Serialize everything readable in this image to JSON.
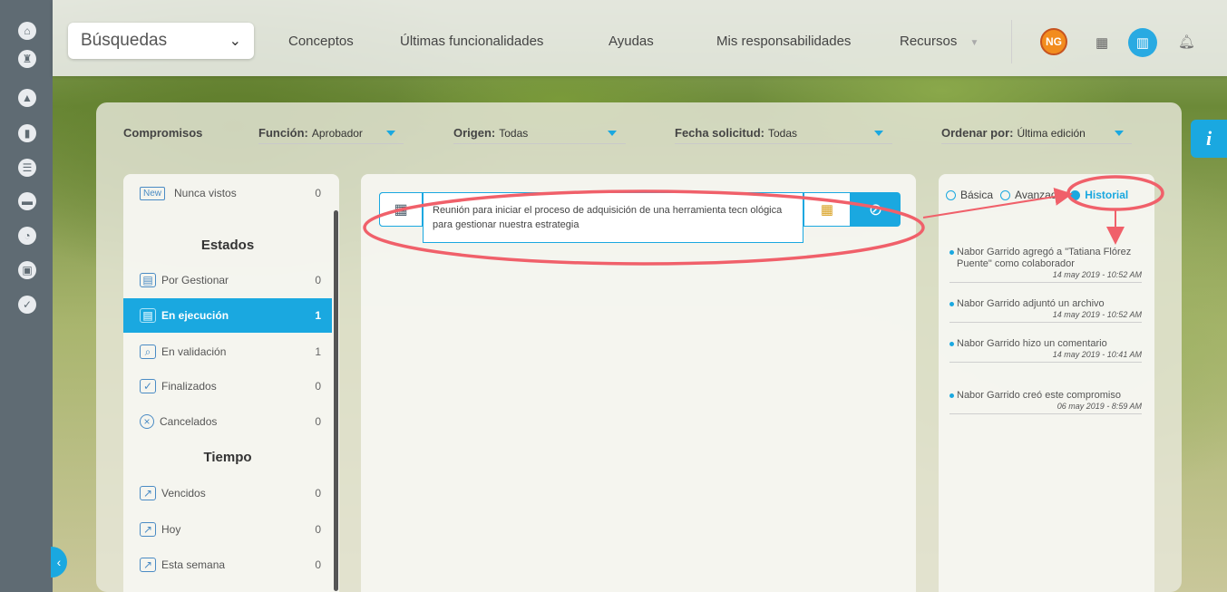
{
  "sidebar": {
    "icons": [
      "home-icon",
      "rook-icon",
      "pyramid-icon",
      "chart-icon",
      "steps-icon",
      "folder-icon",
      "clock-icon",
      "briefcase-icon",
      "check-icon"
    ]
  },
  "topbar": {
    "search_label": "Búsquedas",
    "nav": [
      "Conceptos",
      "Últimas funcionalidades",
      "Ayudas",
      "Mis responsabilidades",
      "Recursos"
    ],
    "avatar_initials": "NG",
    "info_label": "i"
  },
  "filters": {
    "section_label": "Compromisos",
    "funcion_label": "Función:",
    "funcion_value": "Aprobador",
    "origen_label": "Origen:",
    "origen_value": "Todas",
    "fecha_label": "Fecha solicitud:",
    "fecha_value": "Todas",
    "ordenar_label": "Ordenar por:",
    "ordenar_value": "Última edición"
  },
  "left": {
    "new_badge": "New",
    "nunca_vistos": "Nunca vistos",
    "nunca_vistos_count": "0",
    "estados_title": "Estados",
    "estados": [
      {
        "label": "Por Gestionar",
        "count": "0"
      },
      {
        "label": "En ejecución",
        "count": "1"
      },
      {
        "label": "En validación",
        "count": "1"
      },
      {
        "label": "Finalizados",
        "count": "0"
      },
      {
        "label": "Cancelados",
        "count": "0"
      }
    ],
    "tiempo_title": "Tiempo",
    "tiempo": [
      {
        "label": "Vencidos",
        "count": "0"
      },
      {
        "label": "Hoy",
        "count": "0"
      },
      {
        "label": "Esta semana",
        "count": "0"
      }
    ]
  },
  "card": {
    "text": "Reunión para iniciar el proceso de adquisición de una herramienta tecn ológica para gestionar nuestra estrategia"
  },
  "right": {
    "basica": "Básica",
    "avanzada": "Avanzada",
    "historial": "Historial",
    "history": [
      {
        "text": "Nabor Garrido agregó a \"Tatiana Flórez Puente\" como colaborador",
        "date": "14 may 2019 - 10:52 AM"
      },
      {
        "text": "Nabor Garrido adjuntó un archivo",
        "date": "14 may 2019 - 10:52 AM"
      },
      {
        "text": "Nabor Garrido hizo un comentario",
        "date": "14 may 2019 - 10:41 AM"
      },
      {
        "text": "Nabor Garrido creó este compromiso",
        "date": "06 may 2019 - 8:59 AM"
      }
    ]
  },
  "colors": {
    "accent": "#1aa8e0",
    "annotation": "#f0606a",
    "sidebar": "#5f6b73"
  }
}
